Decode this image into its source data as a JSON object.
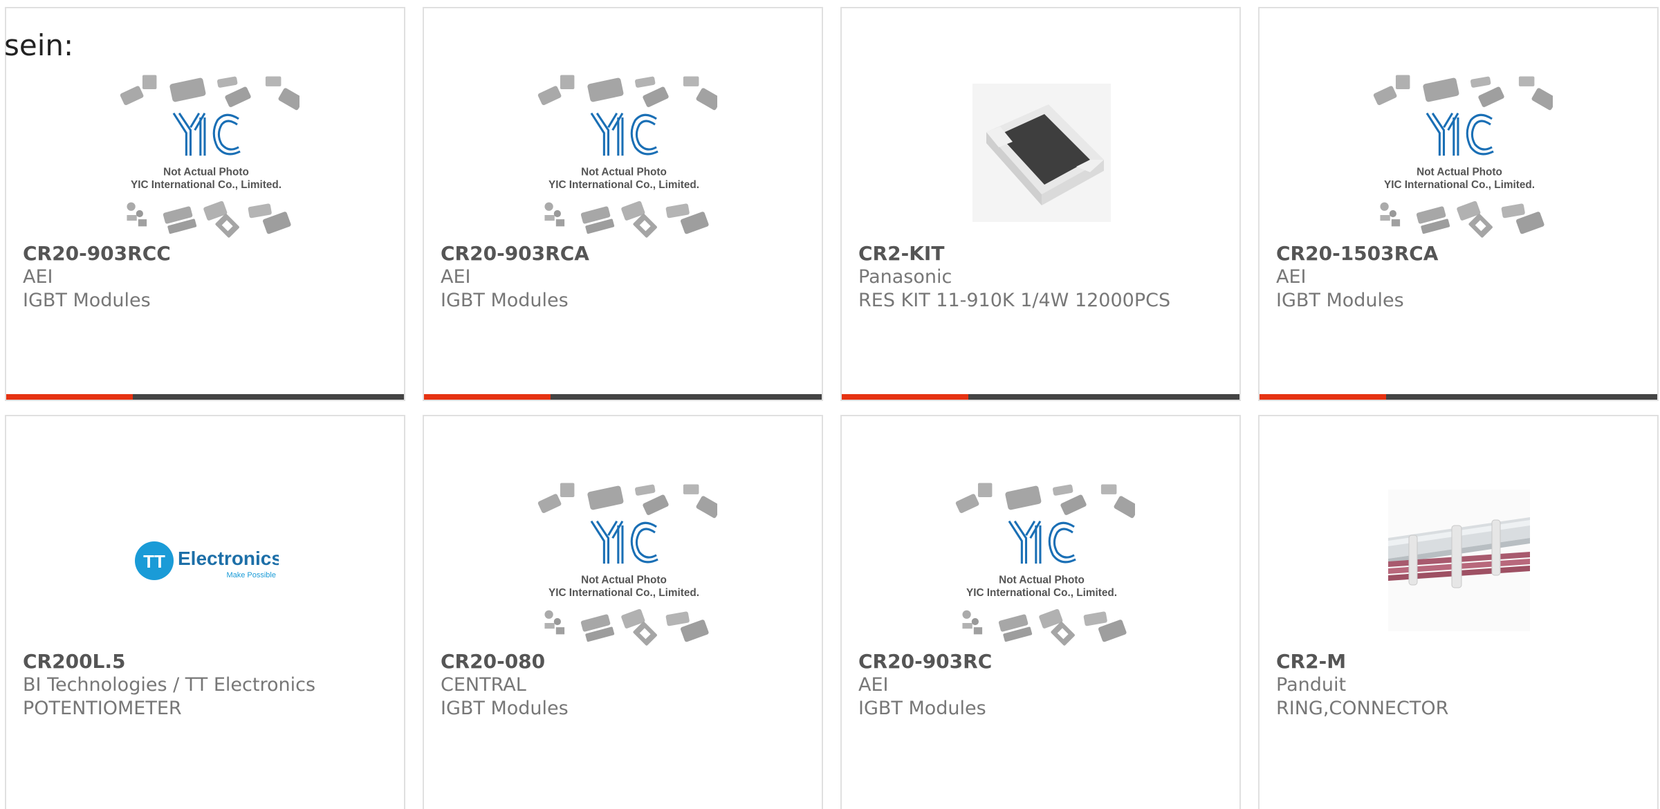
{
  "page": {
    "label": "sein:"
  },
  "colors": {
    "accent": "#e63312",
    "bar": "#444444",
    "yic_blue": "#1a6fb5",
    "tt_blue": "#1a9bd7"
  },
  "placeholder_image": {
    "line1": "Not Actual Photo",
    "line2": "YIC International Co., Limited."
  },
  "tt_logo": {
    "text": "Electronics",
    "tagline": "Make Possible"
  },
  "products": [
    {
      "part": "CR20-903RCC",
      "manufacturer": "AEI",
      "description": "IGBT Modules",
      "image": "yic-placeholder-icon"
    },
    {
      "part": "CR20-903RCA",
      "manufacturer": "AEI",
      "description": "IGBT Modules",
      "image": "yic-placeholder-icon"
    },
    {
      "part": "CR2-KIT",
      "manufacturer": "Panasonic",
      "description": "RES KIT 11-910K 1/4W 12000PCS",
      "image": "chip-resistor-icon"
    },
    {
      "part": "CR20-1503RCA",
      "manufacturer": "AEI",
      "description": "IGBT Modules",
      "image": "yic-placeholder-icon"
    },
    {
      "part": "CR200L.5",
      "manufacturer": "BI Technologies / TT Electronics",
      "description": "POTENTIOMETER",
      "image": "tt-electronics-logo"
    },
    {
      "part": "CR20-080",
      "manufacturer": "CENTRAL",
      "description": "IGBT Modules",
      "image": "yic-placeholder-icon"
    },
    {
      "part": "CR20-903RC",
      "manufacturer": "AEI",
      "description": "IGBT Modules",
      "image": "yic-placeholder-icon"
    },
    {
      "part": "CR2-M",
      "manufacturer": "Panduit",
      "description": "RING,CONNECTOR",
      "image": "cable-tie-icon"
    }
  ]
}
